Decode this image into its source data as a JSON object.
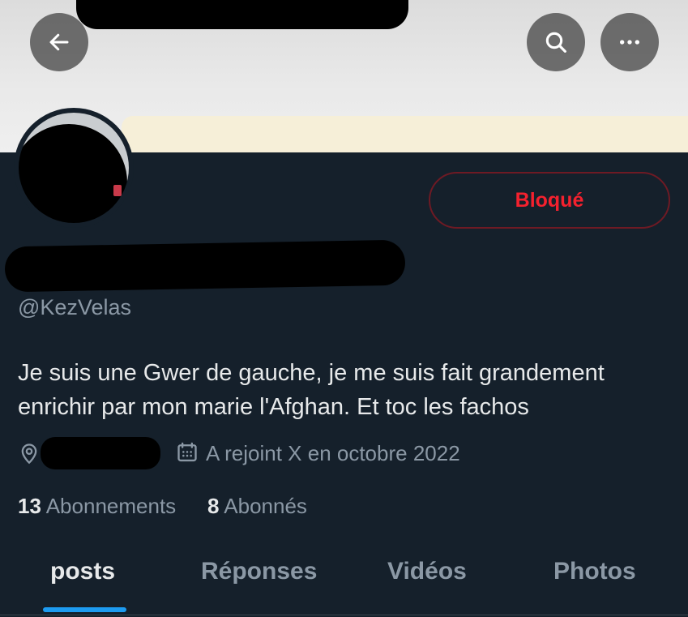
{
  "header": {
    "back_icon": "arrow-left-icon",
    "search_icon": "search-icon",
    "more_icon": "more-horizontal-icon"
  },
  "profile": {
    "blocked_label": "Bloqué",
    "handle": "@KezVelas",
    "bio": "Je suis une Gwer de gauche, je me suis fait grandement enrichir par mon marie l'Afghan. Et toc les fachos",
    "joined": "A rejoint X en octobre 2022",
    "following_count": "13",
    "following_label": "Abonnements",
    "followers_count": "8",
    "followers_label": "Abonnés"
  },
  "tabs": [
    {
      "label": "posts",
      "active": true
    },
    {
      "label": "Réponses",
      "active": false
    },
    {
      "label": "Vidéos",
      "active": false
    },
    {
      "label": "Photos",
      "active": false
    }
  ],
  "colors": {
    "background": "#15202b",
    "blocked_red": "#f4212e",
    "muted_text": "#8b98a5",
    "tab_indicator": "#1d9bf0"
  }
}
